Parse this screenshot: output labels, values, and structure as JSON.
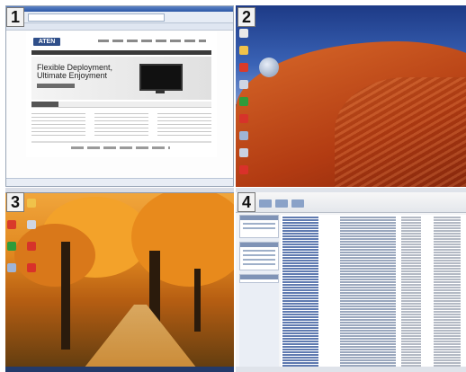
{
  "badges": [
    "1",
    "2",
    "3",
    "4"
  ],
  "browser": {
    "logo_text": "ATEN",
    "hero_line1": "Flexible Deployment,",
    "hero_line2": "Ultimate Enjoyment"
  },
  "colors": {
    "browser_titlebar": "#2b57a6",
    "desert_sky": "#1d3a86",
    "desert_sand": "#b23b12",
    "autumn_leaves": "#e0871f",
    "explorer_bg": "#f4f5f7"
  },
  "icons": {
    "q2_desktop": [
      "recycle-bin-icon",
      "folder-icon",
      "app-icon",
      "app-icon",
      "app-icon",
      "app-icon",
      "app-icon",
      "app-icon",
      "app-icon"
    ],
    "q3_desktop": [
      "recycle-bin-icon",
      "folder-icon",
      "app-icon",
      "app-icon",
      "app-icon",
      "app-icon",
      "app-icon",
      "app-icon"
    ]
  }
}
